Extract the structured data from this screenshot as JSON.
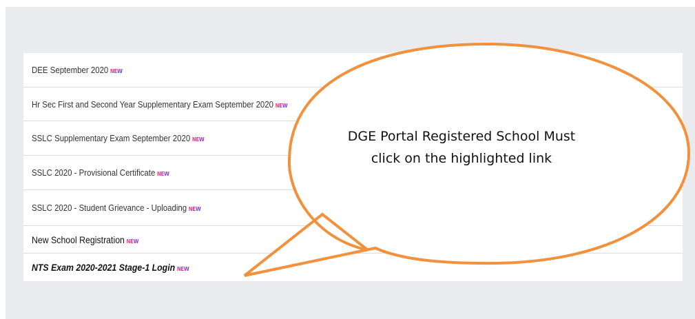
{
  "links": [
    {
      "label": "DEE September 2020",
      "badge": "NEW"
    },
    {
      "label": "Hr Sec First and Second Year Supplementary Exam September 2020",
      "badge": "NEW"
    },
    {
      "label": "SSLC Supplementary Exam September 2020",
      "badge": "NEW"
    },
    {
      "label": "SSLC 2020 - Provisional Certificate",
      "badge": "NEW"
    },
    {
      "label": "SSLC 2020 - Student Grievance - Uploading",
      "badge": "NEW"
    },
    {
      "label": "New School Registration",
      "badge": "NEW"
    },
    {
      "label": "NTS Exam 2020-2021 Stage-1  Login",
      "badge": "NEW"
    }
  ],
  "callout": {
    "line1": "DGE Portal Registered School Must",
    "line2": "click on the highlighted link",
    "stroke_color": "#f2913d"
  },
  "colors": {
    "badge_start": "#ff3c6e",
    "badge_end": "#7a35e6",
    "panel": "#e9ebee"
  }
}
